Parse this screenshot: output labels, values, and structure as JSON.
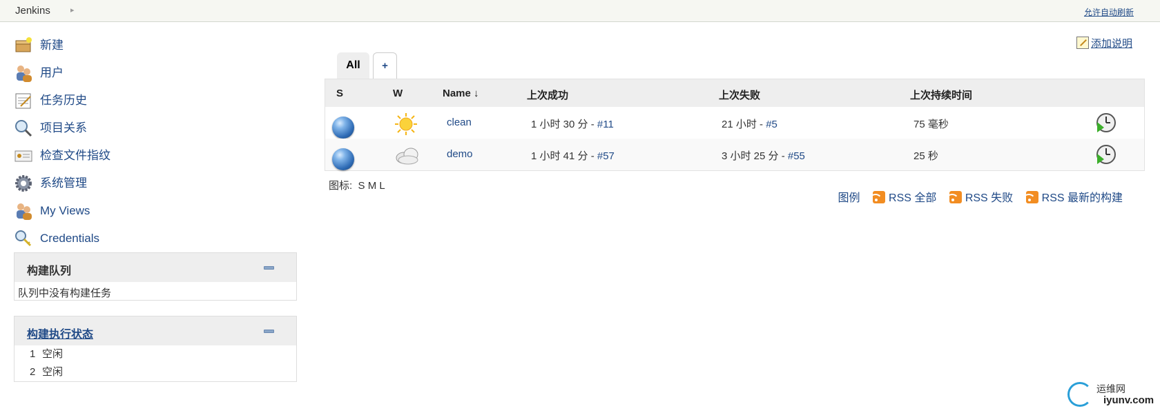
{
  "topbar": {
    "brand": "Jenkins",
    "crumb_arrow": "▸",
    "auto_refresh": "允许自动刷新"
  },
  "sidebar": {
    "tasks": [
      {
        "label": "新建",
        "icon": "new-item-icon"
      },
      {
        "label": "用户",
        "icon": "people-icon"
      },
      {
        "label": "任务历史",
        "icon": "build-history-icon"
      },
      {
        "label": "项目关系",
        "icon": "search-icon"
      },
      {
        "label": "检查文件指纹",
        "icon": "fingerprint-icon"
      },
      {
        "label": "系统管理",
        "icon": "gear-icon"
      },
      {
        "label": "My Views",
        "icon": "user-icon"
      },
      {
        "label": "Credentials",
        "icon": "credentials-icon"
      }
    ],
    "build_queue": {
      "title": "构建队列",
      "empty_text": "队列中没有构建任务"
    },
    "executors": {
      "title": "构建执行状态",
      "items": [
        {
          "num": "1",
          "status": "空闲"
        },
        {
          "num": "2",
          "status": "空闲"
        }
      ]
    }
  },
  "main": {
    "add_description": "添加说明",
    "tabs": {
      "active": "All",
      "new": "+"
    },
    "columns": {
      "s": "S",
      "w": "W",
      "name": "Name ↓",
      "last_success": "上次成功",
      "last_failure": "上次失败",
      "last_duration": "上次持续时间"
    },
    "jobs": [
      {
        "name": "clean",
        "last_success_text": "1 小时 30 分 - ",
        "last_success_build": "#11",
        "last_failure_text": "21 小时 - ",
        "last_failure_build": "#5",
        "duration": "75 毫秒",
        "status": "blue",
        "weather": "sunny"
      },
      {
        "name": "demo",
        "last_success_text": "1 小时 41 分 - ",
        "last_success_build": "#57",
        "last_failure_text": "3 小时 25 分 - ",
        "last_failure_build": "#55",
        "duration": "25 秒",
        "status": "blue",
        "weather": "cloudy"
      }
    ],
    "icon_size": {
      "label": "图标:",
      "s": "S",
      "m": "M",
      "l": "L"
    },
    "footer_links": {
      "legend": "图例",
      "rss_all": "RSS 全部",
      "rss_failed": "RSS 失败",
      "rss_latest": "RSS 最新的构建"
    }
  },
  "watermark": {
    "cn": "运维网",
    "en": "iyunv.com"
  }
}
